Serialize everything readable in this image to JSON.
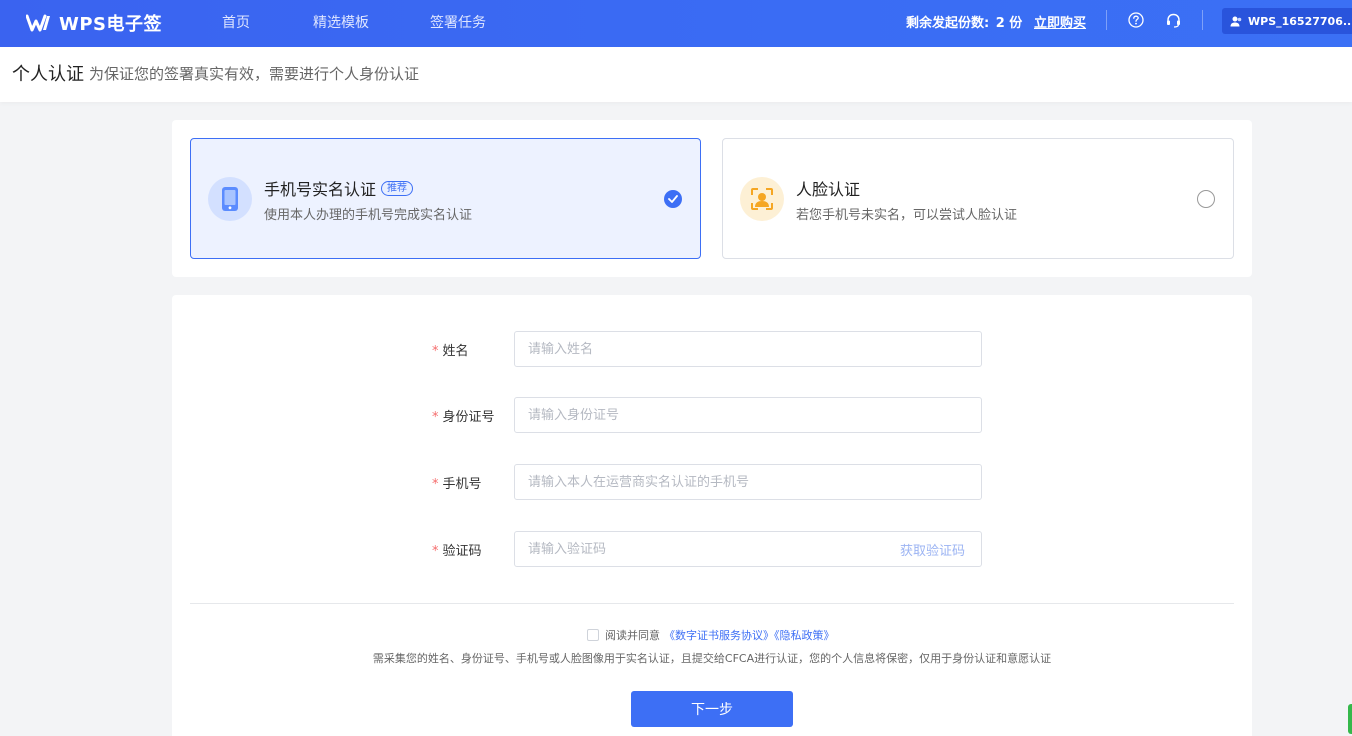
{
  "header": {
    "app_name": "WPS电子签",
    "nav": [
      "首页",
      "精选模板",
      "签署任务"
    ],
    "quota_label": "剩余发起份数:",
    "quota_value": "2 份",
    "buy_label": "立即购买",
    "user_name": "WPS_16527706...",
    "icons": [
      "help-icon",
      "customer-service-icon",
      "user-icon",
      "chevron-up-icon"
    ],
    "colors": {
      "bar": "#3a63f0"
    }
  },
  "subheader": {
    "title": "个人认证",
    "description": "为保证您的签署真实有效，需要进行个人身份认证"
  },
  "methods": [
    {
      "title": "手机号实名认证",
      "badge": "推荐",
      "description": "使用本人办理的手机号完成实名认证",
      "selected": true,
      "icon": "phone-icon"
    },
    {
      "title": "人脸认证",
      "description": "若您手机号未实名，可以尝试人脸认证",
      "selected": false,
      "icon": "face-scan-icon"
    }
  ],
  "form": {
    "fields": [
      {
        "label": "姓名",
        "placeholder": "请输入姓名",
        "required": true
      },
      {
        "label": "身份证号",
        "placeholder": "请输入身份证号",
        "required": true
      },
      {
        "label": "手机号",
        "placeholder": "请输入本人在运营商实名认证的手机号",
        "required": true
      },
      {
        "label": "验证码",
        "placeholder": "请输入验证码",
        "required": true,
        "action": "获取验证码"
      }
    ],
    "required_mark": "*",
    "agree_text": "阅读并同意",
    "agree_links": "《数字证书服务协议》《隐私政策》",
    "notice": "需采集您的姓名、身份证号、手机号或人脸图像用于实名认证，且提交给CFCA进行认证，您的个人信息将保密，仅用于身份认证和意愿认证",
    "next_button": "下一步"
  },
  "colors": {
    "primary": "#3d6ff5",
    "required": "#f56c6c"
  }
}
